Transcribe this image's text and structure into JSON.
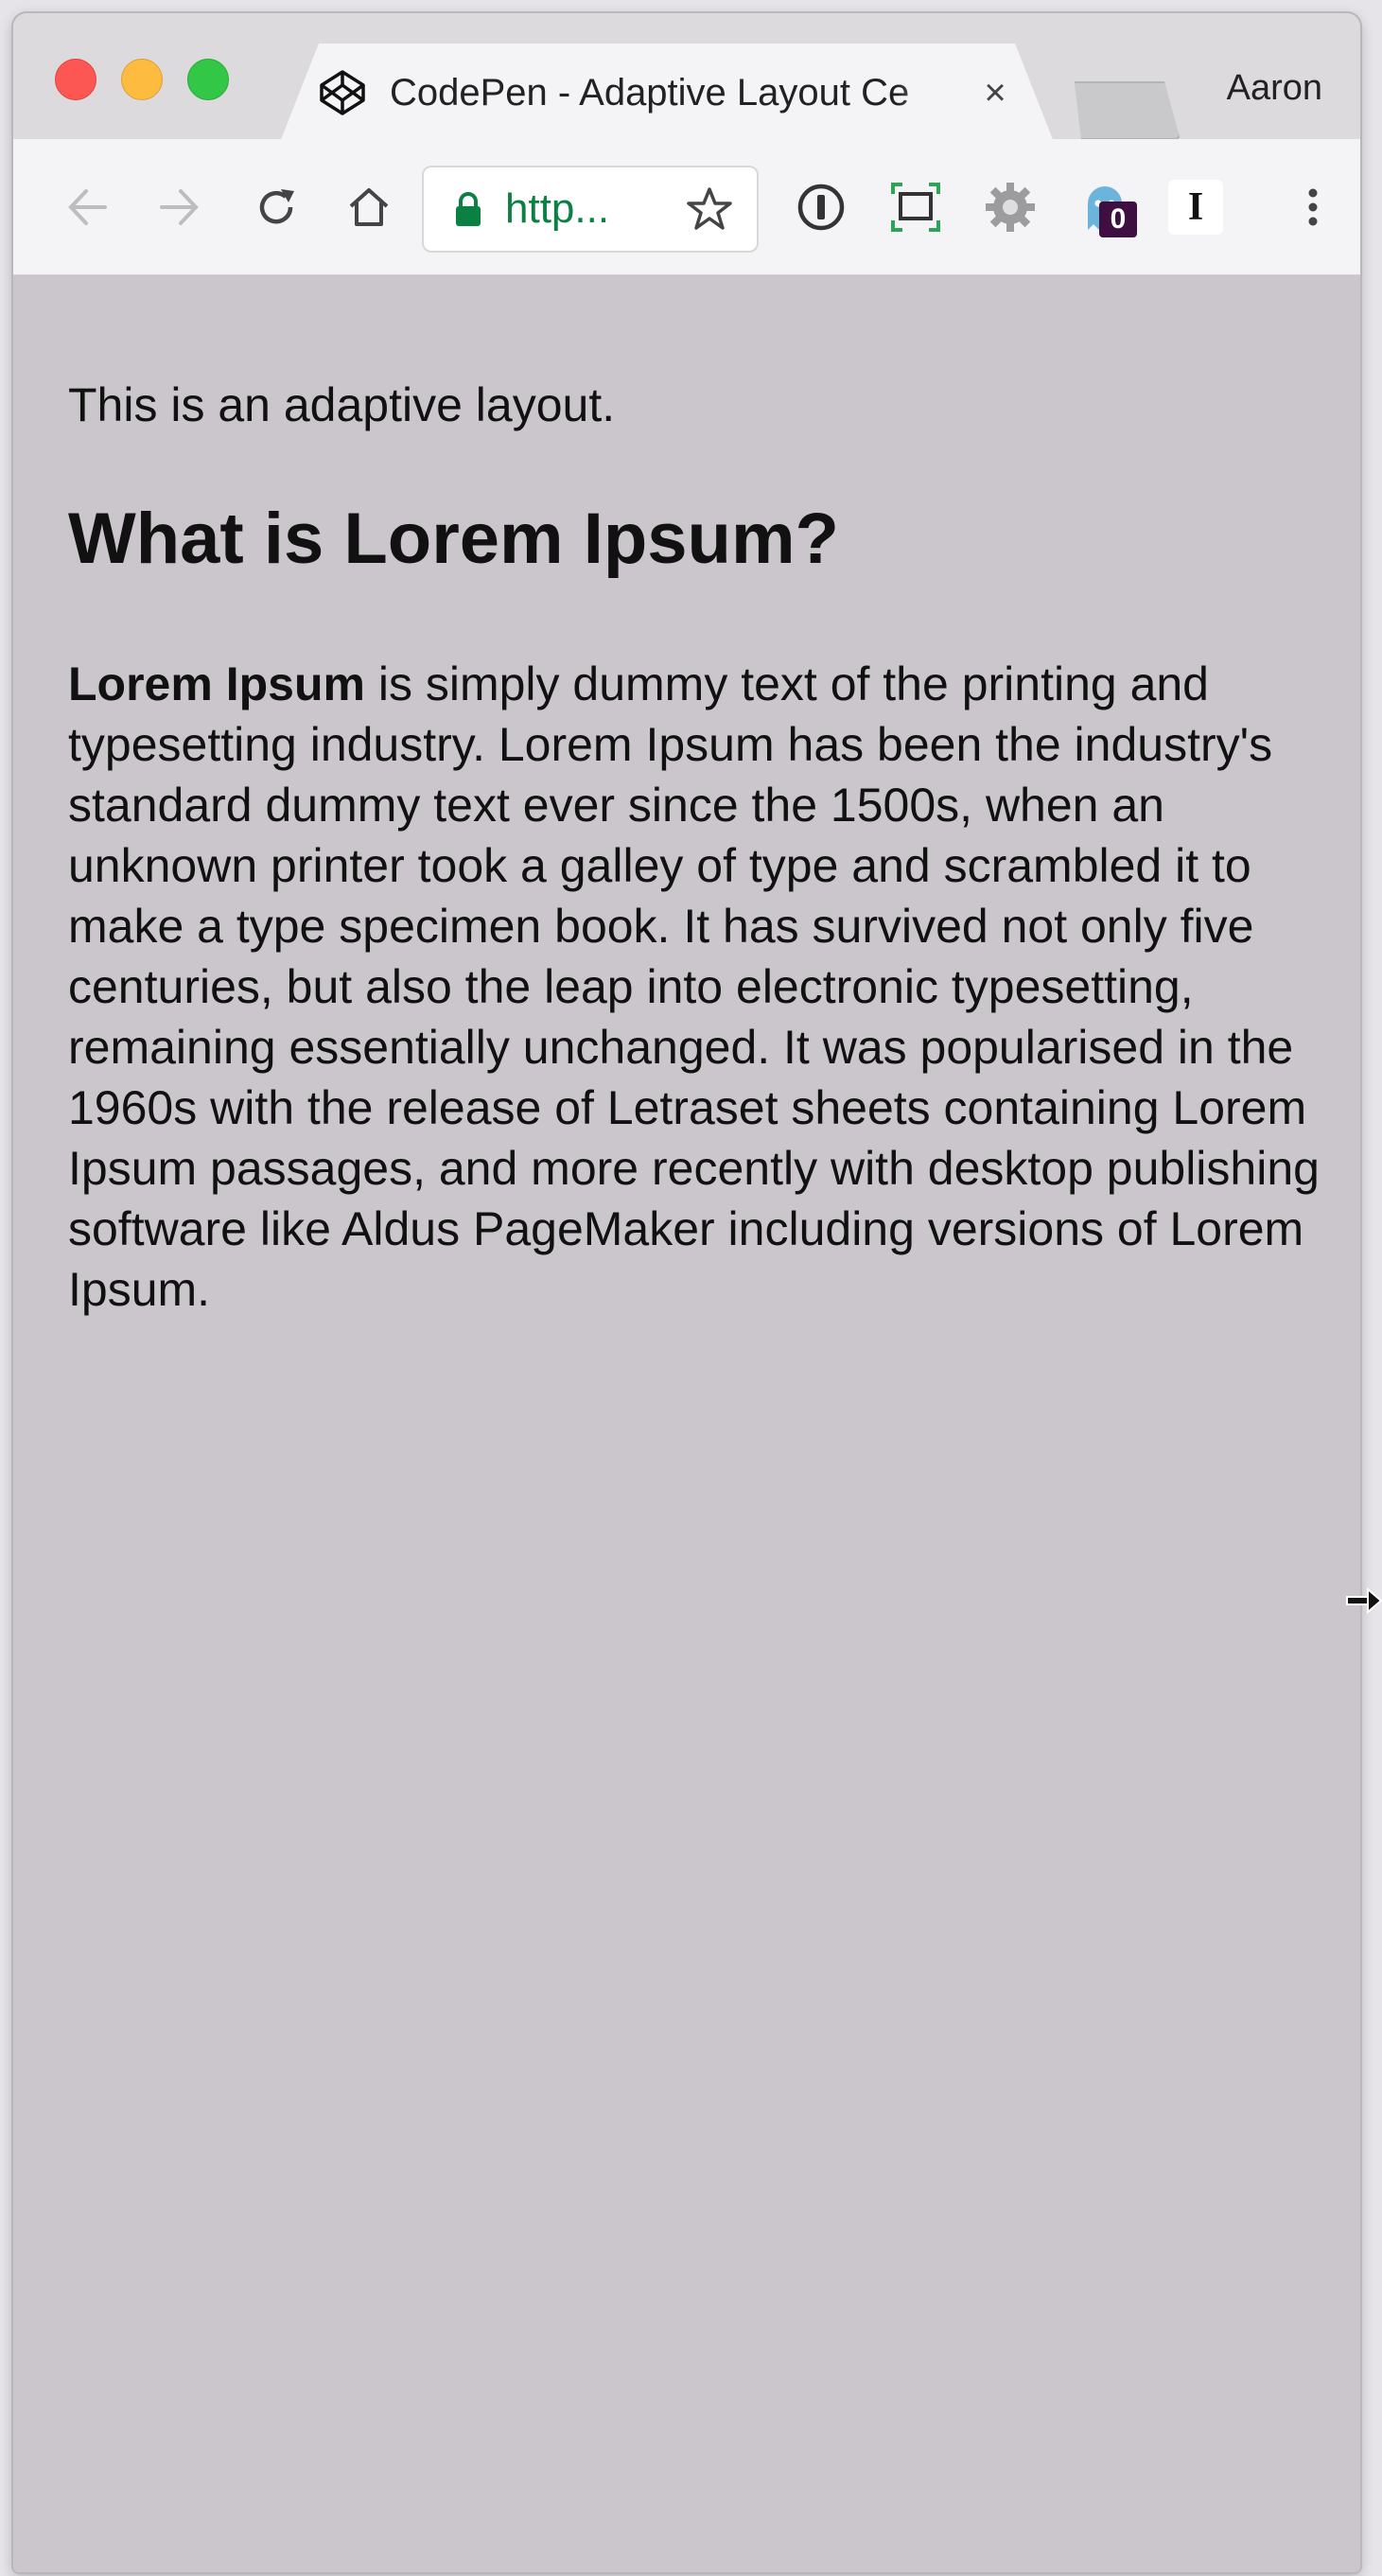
{
  "browser": {
    "tab": {
      "title": "CodePen - Adaptive Layout Ce",
      "close_glyph": "×",
      "icon": "codepen-icon"
    },
    "profile_name": "Aaron",
    "toolbar": {
      "url_display": "http...",
      "extension_badge_count": "0",
      "reader_icon_letter": "I",
      "icons": [
        "back-icon",
        "forward-icon",
        "reload-icon",
        "home-icon",
        "lock-icon",
        "star-icon",
        "onepassword-icon",
        "screenshot-icon",
        "gear-icon",
        "ghostery-icon",
        "instapaper-icon",
        "menu-icon"
      ]
    },
    "traffic_lights": {
      "close_color": "#fc5753",
      "minimize_color": "#fdbc40",
      "maximize_color": "#33c748"
    }
  },
  "page": {
    "background_color": "#cac6cb",
    "intro": "This is an adaptive layout.",
    "heading": "What is Lorem Ipsum?",
    "paragraph_bold": "Lorem Ipsum",
    "paragraph_rest": " is simply dummy text of the printing and typesetting industry. Lorem Ipsum has been the industry's standard dummy text ever since the 1500s, when an unknown printer took a galley of type and scrambled it to make a type specimen book. It has survived not only five centuries, but also the leap into electronic typesetting, remaining essentially unchanged. It was popularised in the 1960s with the release of Letraset sheets containing Lorem Ipsum passages, and more recently with desktop publishing software like Aldus PageMaker including versions of Lorem Ipsum."
  }
}
